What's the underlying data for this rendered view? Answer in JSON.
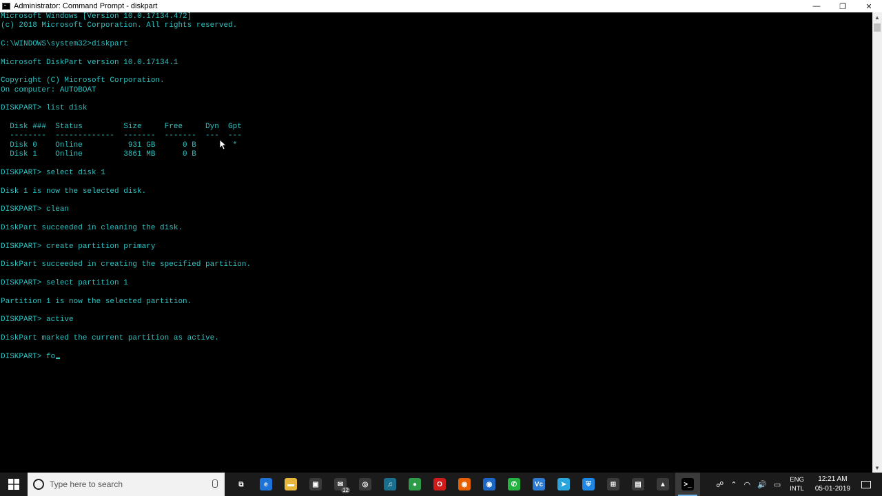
{
  "window": {
    "title": "Administrator: Command Prompt - diskpart",
    "minimize": "—",
    "restore": "❐",
    "close": "✕"
  },
  "console": {
    "lines": [
      "Microsoft Windows [Version 10.0.17134.472]",
      "(c) 2018 Microsoft Corporation. All rights reserved.",
      "",
      "C:\\WINDOWS\\system32>diskpart",
      "",
      "Microsoft DiskPart version 10.0.17134.1",
      "",
      "Copyright (C) Microsoft Corporation.",
      "On computer: AUTOBOAT",
      "",
      "DISKPART> list disk",
      "",
      "  Disk ###  Status         Size     Free     Dyn  Gpt",
      "  --------  -------------  -------  -------  ---  ---",
      "  Disk 0    Online          931 GB      0 B        *",
      "  Disk 1    Online         3861 MB      0 B",
      "",
      "DISKPART> select disk 1",
      "",
      "Disk 1 is now the selected disk.",
      "",
      "DISKPART> clean",
      "",
      "DiskPart succeeded in cleaning the disk.",
      "",
      "DISKPART> create partition primary",
      "",
      "DiskPart succeeded in creating the specified partition.",
      "",
      "DISKPART> select partition 1",
      "",
      "Partition 1 is now the selected partition.",
      "",
      "DISKPART> active",
      "",
      "DiskPart marked the current partition as active.",
      ""
    ],
    "prompt": "DISKPART> ",
    "current_input": "fo",
    "text_color": "#2ec2c2"
  },
  "taskbar": {
    "search_placeholder": "Type here to search",
    "apps": [
      {
        "icon": "task-view-icon",
        "glyph": "⧉",
        "color": "#1b1b1b"
      },
      {
        "icon": "edge-icon",
        "glyph": "e",
        "color": "#1e73d8"
      },
      {
        "icon": "file-explorer-icon",
        "glyph": "▬",
        "color": "#e8b63a"
      },
      {
        "icon": "store-icon",
        "glyph": "▣",
        "color": "#3a3a3a"
      },
      {
        "icon": "mail-icon",
        "glyph": "✉",
        "color": "#3a3a3a"
      },
      {
        "icon": "media-icon",
        "glyph": "◎",
        "color": "#3a3a3a"
      },
      {
        "icon": "amazon-music-icon",
        "glyph": "♫",
        "color": "#1a6f8f"
      },
      {
        "icon": "chrome-icon",
        "glyph": "●",
        "color": "#2d9b48"
      },
      {
        "icon": "opera-icon",
        "glyph": "O",
        "color": "#d01b1b"
      },
      {
        "icon": "firefox-icon",
        "glyph": "◉",
        "color": "#e66000"
      },
      {
        "icon": "firefox-dev-icon",
        "glyph": "◉",
        "color": "#1c67c6"
      },
      {
        "icon": "whatsapp-icon",
        "glyph": "✆",
        "color": "#25b240"
      },
      {
        "icon": "vs-code-icon",
        "glyph": "Vc",
        "color": "#2a7bd1"
      },
      {
        "icon": "telegram-icon",
        "glyph": "➤",
        "color": "#2aa4dc"
      },
      {
        "icon": "security-shield-icon",
        "glyph": "⛨",
        "color": "#1e87e5"
      },
      {
        "icon": "network-icon",
        "glyph": "⊞",
        "color": "#3a3a3a"
      },
      {
        "icon": "video-editor-icon",
        "glyph": "▤",
        "color": "#3a3a3a"
      },
      {
        "icon": "photos-icon",
        "glyph": "▲",
        "color": "#3a3a3a"
      },
      {
        "icon": "command-prompt-icon",
        "glyph": ">_",
        "color": "#000000"
      }
    ],
    "mail_badge": "12",
    "tray_people": "☍",
    "tray_up": "⌃",
    "tray_wifi": "◠",
    "tray_volume": "🔊",
    "tray_battery": "▭",
    "lang_top": "ENG",
    "lang_bottom": "INTL",
    "time": "12:21 AM",
    "date": "05-01-2019"
  }
}
